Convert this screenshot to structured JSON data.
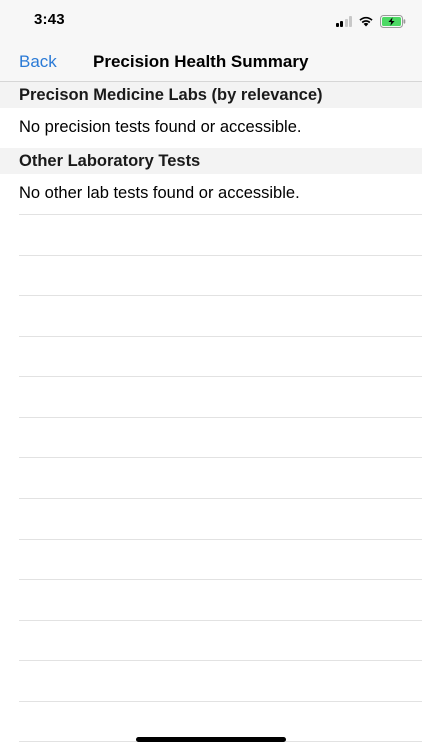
{
  "status_bar": {
    "time": "3:43",
    "icons": [
      "cellular-signal-icon",
      "wifi-icon",
      "battery-charging-icon"
    ],
    "battery_color": "#4cd964"
  },
  "nav": {
    "back_label": "Back",
    "title": "Precision Health Summary",
    "accent_color": "#2a7ad6"
  },
  "sections": [
    {
      "header": "Precison Medicine Labs (by relevance)",
      "message": "No precision tests found or accessible."
    },
    {
      "header": "Other Laboratory Tests",
      "message": "No other lab tests found or accessible."
    }
  ]
}
